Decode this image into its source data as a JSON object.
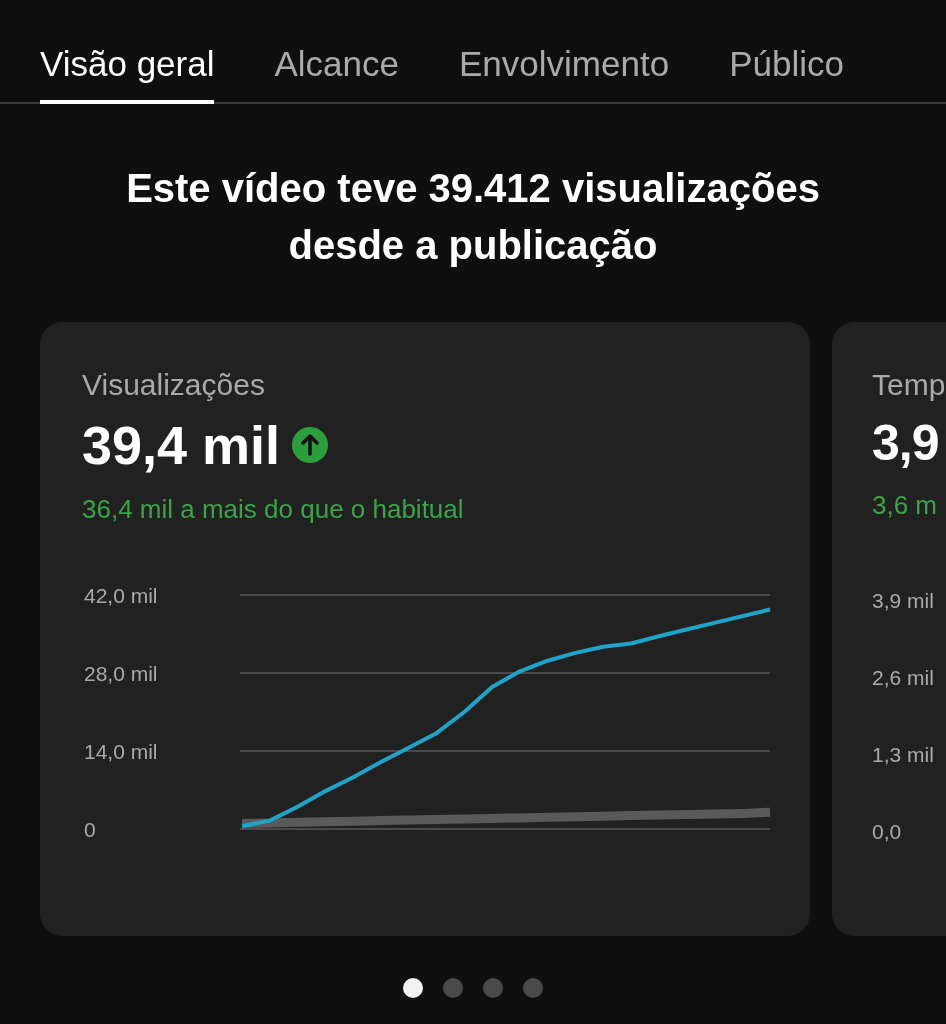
{
  "tabs": [
    {
      "label": "Visão geral",
      "selected": true
    },
    {
      "label": "Alcance",
      "selected": false
    },
    {
      "label": "Envolvimento",
      "selected": false
    },
    {
      "label": "Público",
      "selected": false
    }
  ],
  "headline": "Este vídeo teve 39.412 visualizações desde a publicação",
  "cards": [
    {
      "title": "Visualizações",
      "value": "39,4 mil",
      "trend_up": true,
      "delta": "36,4 mil a mais do que o habitual",
      "chart_data": {
        "type": "line",
        "categories": [
          null,
          null,
          null,
          null,
          null,
          null,
          null,
          null,
          null,
          null,
          null,
          null,
          null,
          null,
          null,
          null,
          null,
          null,
          null,
          null
        ],
        "series": [
          {
            "color": "#1fa3c8",
            "values": [
              0.5,
              1.5,
              4,
              6.8,
              9.3,
              12,
              14.6,
              17.2,
              21,
              25.5,
              28.3,
              30.2,
              31.6,
              32.7,
              33.3,
              34.6,
              35.8,
              37,
              38.2,
              39.4
            ]
          },
          {
            "color": "#5a5a5a",
            "values": [
              1,
              1.1,
              1.2,
              1.3,
              1.4,
              1.5,
              1.6,
              1.7,
              1.8,
              1.9,
              2,
              2.1,
              2.2,
              2.3,
              2.4,
              2.5,
              2.6,
              2.7,
              2.8,
              3
            ]
          }
        ],
        "ylim": [
          0,
          42
        ],
        "yticks": [
          {
            "value": 0,
            "label": "0"
          },
          {
            "value": 14,
            "label": "14,0 mil"
          },
          {
            "value": 28,
            "label": "28,0 mil"
          },
          {
            "value": 42,
            "label": "42,0 mil"
          }
        ]
      }
    },
    {
      "title": "Temp",
      "value": "3,9",
      "delta": "3,6 m",
      "y_axis_labels": [
        "3,9 mil",
        "2,6 mil",
        "1,3 mil",
        "0,0"
      ]
    }
  ],
  "pager": [
    {
      "selected": true
    },
    {
      "selected": false
    },
    {
      "selected": false
    },
    {
      "selected": false
    }
  ]
}
